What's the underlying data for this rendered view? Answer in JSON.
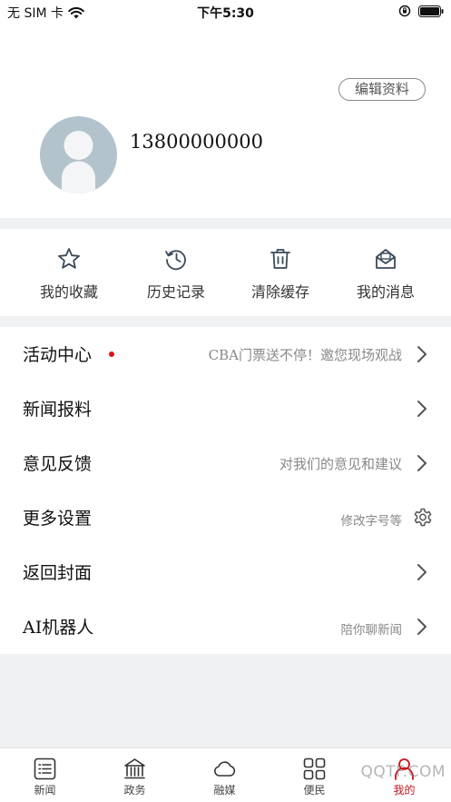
{
  "status_bar": {
    "carrier": "无 SIM 卡",
    "time": "下午5:30"
  },
  "profile": {
    "edit_label": "编辑资料",
    "phone": "13800000000"
  },
  "quick_actions": [
    {
      "label": "我的收藏",
      "icon": "star-icon"
    },
    {
      "label": "历史记录",
      "icon": "history-icon"
    },
    {
      "label": "清除缓存",
      "icon": "trash-icon"
    },
    {
      "label": "我的消息",
      "icon": "message-icon"
    }
  ],
  "menu": [
    {
      "title": "活动中心",
      "subtitle": "CBA门票送不停！邀您现场观战",
      "badge": true,
      "icon": "chevron-right-icon"
    },
    {
      "title": "新闻报料",
      "subtitle": "",
      "icon": "chevron-right-icon"
    },
    {
      "title": "意见反馈",
      "subtitle": "对我们的意见和建议",
      "icon": "chevron-right-icon"
    },
    {
      "title": "更多设置",
      "subtitle": "修改字号等",
      "icon": "gear-icon"
    },
    {
      "title": "返回封面",
      "subtitle": "",
      "icon": "chevron-right-icon"
    },
    {
      "title": "AI机器人",
      "subtitle": "陪你聊新闻",
      "icon": "chevron-right-icon"
    }
  ],
  "tabbar": [
    {
      "label": "新闻",
      "icon": "news-icon"
    },
    {
      "label": "政务",
      "icon": "government-icon"
    },
    {
      "label": "融媒",
      "icon": "cloud-icon"
    },
    {
      "label": "便民",
      "icon": "grid-icon"
    },
    {
      "label": "我的",
      "icon": "user-icon",
      "active": true
    }
  ],
  "watermark": "QQTF.COM",
  "colors": {
    "accent": "#c8161d",
    "badge": "#e0101a",
    "icon": "#3a4a5a",
    "avatar": "#b3c3cb"
  }
}
